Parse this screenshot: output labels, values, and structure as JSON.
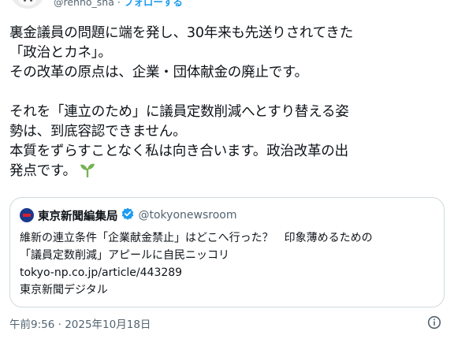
{
  "header": {
    "handle": "@renho_sha",
    "separator": "·",
    "follow_label": "フォローする"
  },
  "tweet": {
    "lines": [
      "裏金議員の問題に端を発し、30年来も先送りされてきた",
      "「政治とカネ」。",
      "その改革の原点は、企業・団体献金の廃止です。",
      "",
      "それを「連立のため」に議員定数削減へとすり替える姿",
      "勢は、到底容認できません。",
      "本質をずらすことなく私は向き合います。政治改革の出",
      "発点です。"
    ],
    "emoji_icon": "seedling-icon"
  },
  "quote": {
    "logo_icon": "tokyo-shimbun-logo",
    "name": "東京新聞編集局",
    "verified_icon": "verified-badge-icon",
    "handle": "@tokyonewsroom",
    "lines": [
      "維新の連立条件「企業献金禁止」はどこへ行った？　印象薄めるための",
      "「議員定数削減」アピールに自民ニッコリ",
      "tokyo-np.co.jp/article/443289",
      "東京新聞デジタル"
    ]
  },
  "meta": {
    "timestamp": "午前9:56 · 2025年10月18日",
    "info_icon": "info-icon"
  },
  "colors": {
    "link": "#1d9bf0",
    "secondary_text": "#536471",
    "border": "#cfd9de"
  }
}
